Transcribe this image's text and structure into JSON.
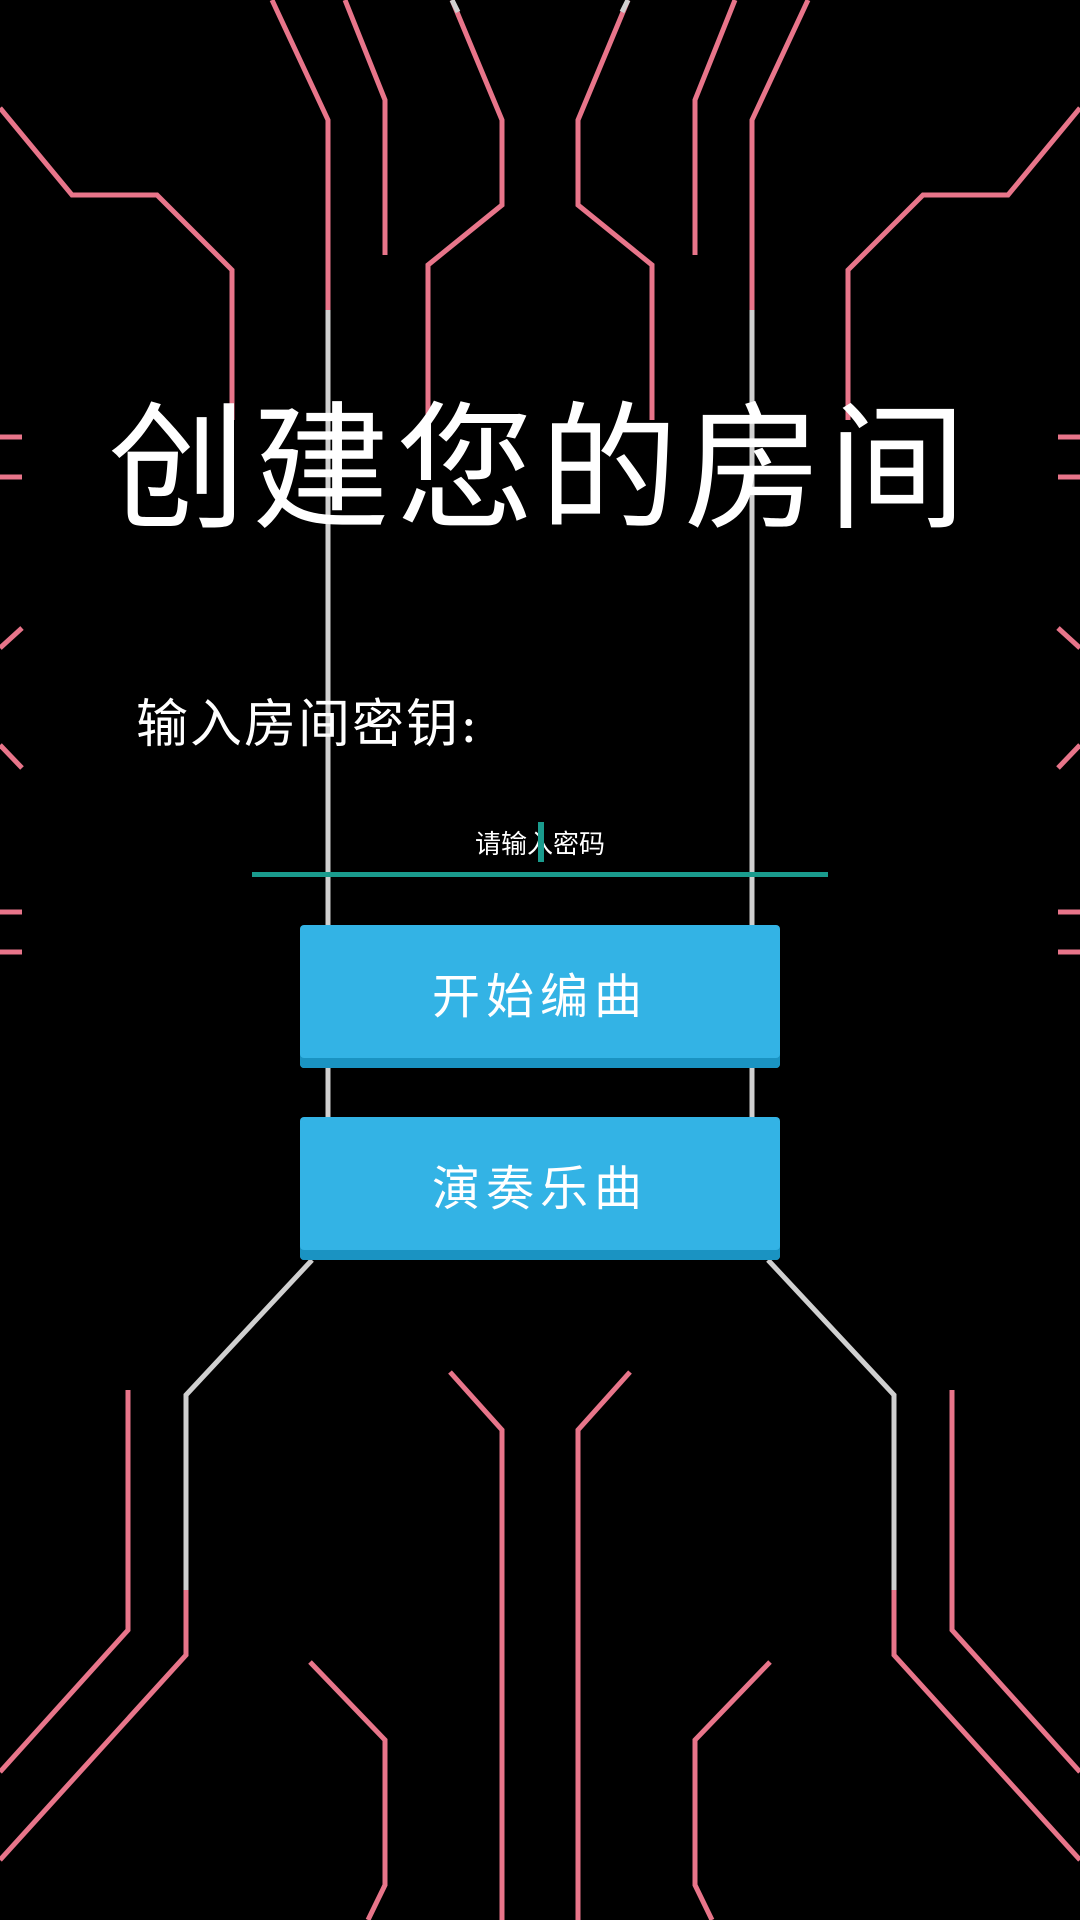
{
  "title": "创建您的房间",
  "room_key": {
    "label": "输入房间密钥:",
    "value": "",
    "placeholder": "请输入密码"
  },
  "buttons": {
    "compose_label": "开始编曲",
    "play_label": "演奏乐曲"
  },
  "colors": {
    "background": "#000000",
    "circuit_pink": "#e8758a",
    "circuit_gray": "#d0d0d0",
    "input_underline": "#1a9b8d",
    "button": "#33b3e5"
  }
}
